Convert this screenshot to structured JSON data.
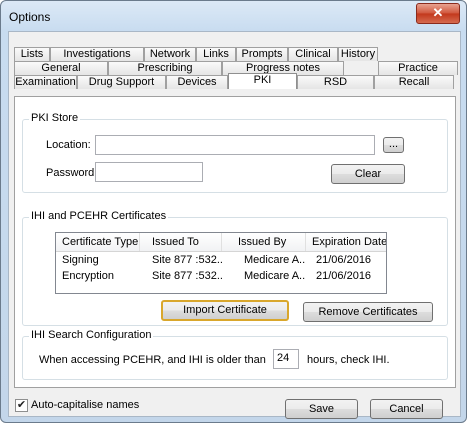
{
  "window": {
    "title": "Options",
    "close_glyph": "✕"
  },
  "tabs": {
    "row1": [
      "Lists",
      "Investigations",
      "Network",
      "Links",
      "Prompts",
      "Clinical",
      "History"
    ],
    "row2": [
      "General",
      "Prescribing",
      "Progress notes",
      "Practice"
    ],
    "row3": [
      "Examination",
      "Drug Support",
      "Devices",
      "PKI",
      "RSD",
      "Recall"
    ],
    "active": "PKI"
  },
  "pki_store": {
    "group_title": "PKI Store",
    "location_label": "Location:",
    "location_value": "",
    "password_label": "Password:",
    "password_value": "",
    "browse_label": "...",
    "clear_label": "Clear"
  },
  "certificates": {
    "group_title": "IHI and PCEHR Certificates",
    "columns": [
      "Certificate Type",
      "Issued To",
      "Issued By",
      "Expiration Date"
    ],
    "rows": [
      [
        "Signing",
        "Site 877 :532...",
        "Medicare A...",
        "21/06/2016"
      ],
      [
        "Encryption",
        "Site 877 :532...",
        "Medicare A...",
        "21/06/2016"
      ]
    ],
    "import_label": "Import Certificate",
    "remove_label": "Remove Certificates"
  },
  "ihi_search": {
    "group_title": "IHI Search Configuration",
    "text_before": "When accessing PCEHR, and IHI is older than",
    "hours_value": "24",
    "text_after": "hours, check IHI."
  },
  "footer": {
    "auto_capitalise_label": "Auto-capitalise names",
    "auto_capitalise_checked": true,
    "check_glyph": "✔",
    "save_label": "Save",
    "cancel_label": "Cancel"
  }
}
